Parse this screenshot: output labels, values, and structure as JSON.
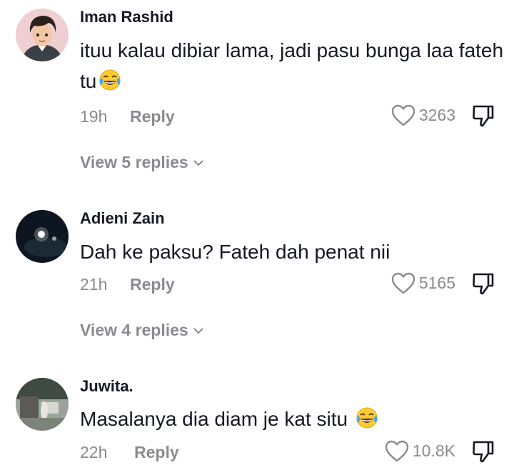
{
  "comments": [
    {
      "username": "Iman Rashid",
      "text": "ituu kalau dibiar lama, jadi pasu bunga laa fateh tu",
      "emoji": "laughing-tears-emoji",
      "time": "19h",
      "reply_label": "Reply",
      "likes": "3263",
      "view_replies": "View 5 replies",
      "avatar": "cartoon-avatar"
    },
    {
      "username": "Adieni Zain",
      "text": "Dah ke paksu? Fateh dah penat nii",
      "time": "21h",
      "reply_label": "Reply",
      "likes": "5165",
      "view_replies": "View 4 replies",
      "avatar": "night-light-avatar"
    },
    {
      "username": "Juwita.",
      "text": "Masalanya dia diam je kat situ",
      "emoji": "laughing-tears-emoji",
      "time": "22h",
      "reply_label": "Reply",
      "likes": "10.8K",
      "avatar": "outdoor-photo-avatar"
    }
  ],
  "icons": {
    "like": "heart-outline-icon",
    "dislike": "thumbs-down-icon",
    "expand": "chevron-down-icon"
  },
  "colors": {
    "primary_text": "#161823",
    "secondary_text": "#8a8b91",
    "background": "#ffffff"
  }
}
